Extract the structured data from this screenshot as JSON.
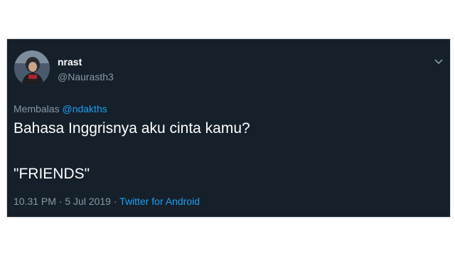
{
  "tweet": {
    "display_name": "nrast",
    "handle": "@Naurasth3",
    "reply_prefix": "Membalas",
    "reply_mention": "@ndakths",
    "text_line_1": "Bahasa Inggrisnya aku cinta kamu?",
    "text_line_2": "\"FRIENDS\"",
    "timestamp": "10.31 PM · 5 Jul 2019 ·",
    "source": "Twitter for Android"
  },
  "icons": {
    "menu": "chevron-down-icon",
    "avatar": "avatar"
  },
  "colors": {
    "card_background": "#15202b",
    "primary_text": "#ffffff",
    "secondary_text": "#8899a6",
    "accent": "#1da1f2"
  }
}
